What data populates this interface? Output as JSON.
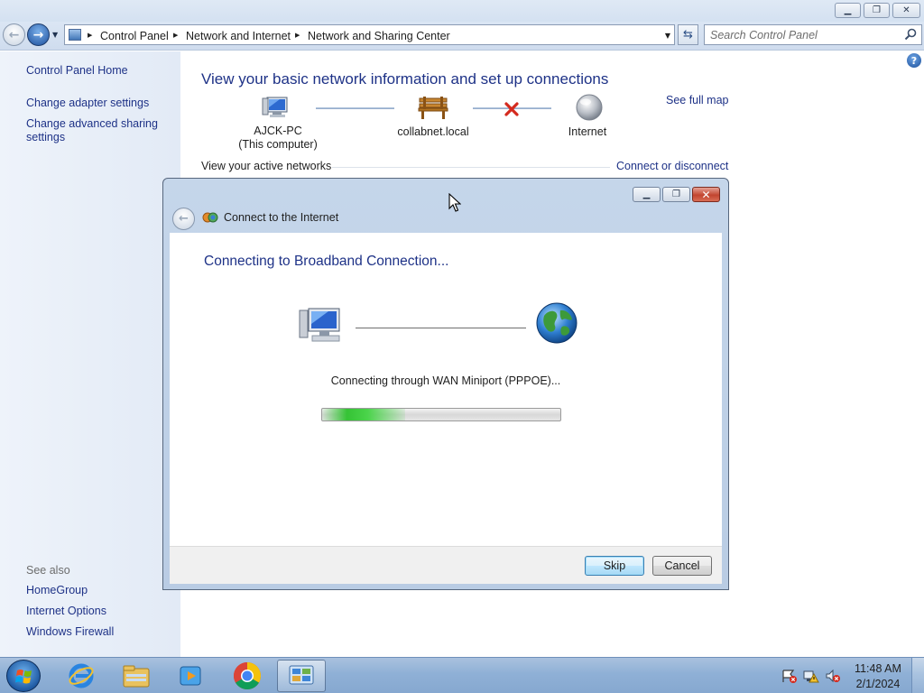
{
  "window": {
    "minimize_glyph": "▁",
    "restore_glyph": "❐",
    "close_glyph": "✕"
  },
  "address_bar": {
    "crumbs": [
      "Control Panel",
      "Network and Internet",
      "Network and Sharing Center"
    ],
    "search_placeholder": "Search Control Panel"
  },
  "sidebar": {
    "links": [
      "Control Panel Home",
      "Change adapter settings",
      "Change advanced sharing settings"
    ],
    "see_also_label": "See also",
    "see_also_links": [
      "HomeGroup",
      "Internet Options",
      "Windows Firewall"
    ]
  },
  "main": {
    "title": "View your basic network information and set up connections",
    "see_full_map": "See full map",
    "map": {
      "computer_name": "AJCK-PC",
      "computer_sub": "(This computer)",
      "network_name": "collabnet.local",
      "internet_label": "Internet"
    },
    "active_networks_label": "View your active networks",
    "connect_or_disconnect": "Connect or disconnect"
  },
  "dialog": {
    "title": "Connect to the Internet",
    "heading": "Connecting to Broadband Connection...",
    "status": "Connecting through WAN Miniport (PPPOE)...",
    "progress_fraction": 0.35,
    "skip_label": "Skip",
    "cancel_label": "Cancel"
  },
  "taskbar": {
    "apps": [
      "internet-explorer-icon",
      "windows-explorer-icon",
      "media-player-icon",
      "chrome-icon",
      "control-panel-icon"
    ],
    "tray_icons": [
      "action-center-icon",
      "network-icon",
      "volume-muted-icon"
    ],
    "time": "11:48 AM",
    "date": "2/1/2024"
  },
  "colors": {
    "link_blue": "#1e3287",
    "heading_blue": "#1e3287",
    "progress_green": "#35c335",
    "disconnect_red": "#d42a1e"
  }
}
